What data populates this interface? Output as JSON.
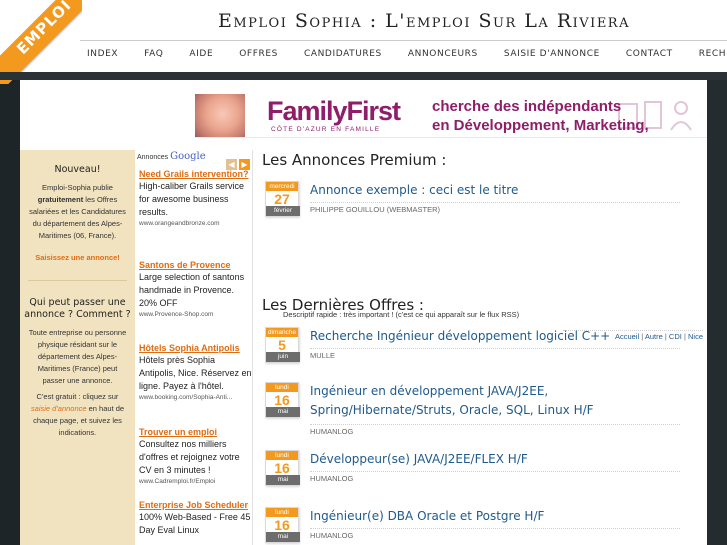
{
  "header": {
    "ribbon": "EMPLOI",
    "site_title": "Emploi Sophia : L'emploi Sur La Riviera"
  },
  "nav": [
    {
      "label": "INDEX"
    },
    {
      "label": "FAQ"
    },
    {
      "label": "AIDE"
    },
    {
      "label": "OFFRES"
    },
    {
      "label": "CANDIDATURES"
    },
    {
      "label": "ANNONCEURS"
    },
    {
      "label": "SAISIE D'ANNONCE"
    },
    {
      "label": "CONTACT"
    },
    {
      "label": "RECHERCHE"
    }
  ],
  "banner": {
    "logo": "FamilyFirst",
    "subtitle": "CÔTE D'AZUR EN FAMILLE",
    "line1": "cherche des indépendants",
    "line2": "en Développement, Marketing, Ventes..."
  },
  "left": {
    "nouveau_title": "Nouveau!",
    "nouveau_1": "Emploi-Sophia publie",
    "nouveau_bold": "gratuitement",
    "nouveau_2": " les Offres salariées et les Candidatures du département des Alpes-Maritimes (06, France).",
    "saisissez": "Saisissez une annonce!",
    "qui_title": "Qui peut passer une annonce ? Comment ?",
    "qui_text": "Toute entreprise ou personne physique résidant sur le département des Alpes-Maritimes (France) peut passer une annonce.",
    "gratuit_1": "C'est gratuit : cliquez sur ",
    "gratuit_link": "saisie d'annonce",
    "gratuit_2": " en haut de chaque page, et suivez les indications."
  },
  "ads": {
    "brand_prefix": "Annonces",
    "brand_google": "Google",
    "items": [
      {
        "title": "Need Grails intervention?",
        "body": "High-caliber Grails service for awesome business results.",
        "url": "www.orangeandbronze.com"
      },
      {
        "title": "Santons de Provence",
        "body": "Large selection of santons handmade in Provence. 20% OFF",
        "url": "www.Provence-Shop.com"
      },
      {
        "title": "Hôtels Sophia Antipolis",
        "body": "Hôtels près Sophia Antipolis, Nice. Réservez en ligne. Payez à l'hôtel.",
        "url": "www.booking.com/Sophia-Anti..."
      },
      {
        "title": "Trouver un emploi",
        "body": "Consultez nos milliers d'offres et rejoignez votre CV en 3 minutes !",
        "url": "www.Cadremploi.fr/Emploi"
      },
      {
        "title": "Enterprise Job Scheduler",
        "body": "100% Web-Based - Free 45 Day Eval Linux",
        "url": ""
      }
    ]
  },
  "premium": {
    "title": "Les Annonces Premium :",
    "item": {
      "day": "mercredi",
      "num": "27",
      "month": "février",
      "title": "Annonce exemple : ceci est le titre",
      "author": "PHILIPPE GOUILLOU (WEBMASTER)"
    },
    "desc": "Descriptif rapide : très important ! (c'est ce qui apparaît sur le flux RSS)",
    "cats": [
      "Accueil",
      "Autre",
      "CDI",
      "Nice"
    ]
  },
  "offres": {
    "title": "Les Dernières Offres :",
    "items": [
      {
        "day": "dimanche",
        "num": "5",
        "month": "juin",
        "title": "Recherche Ingénieur développement logiciel C++",
        "author": "MULLE"
      },
      {
        "day": "lundi",
        "num": "16",
        "month": "mai",
        "title": "Ingénieur en développement JAVA/J2EE, Spring/Hibernate/Struts, Oracle, SQL, Linux H/F",
        "author": "HUMANLOG"
      },
      {
        "day": "lundi",
        "num": "16",
        "month": "mai",
        "title": "Développeur(se) JAVA/J2EE/FLEX H/F",
        "author": "HUMANLOG"
      },
      {
        "day": "lundi",
        "num": "16",
        "month": "mai",
        "title": "Ingénieur(e) DBA Oracle et Postgre H/F",
        "author": "HUMANLOG"
      }
    ]
  },
  "colors": {
    "accent": "#f39a1e",
    "link": "#1f5a8c",
    "sidebar_bg": "#f1e3bf",
    "brand": "#8e1e6a",
    "background": "#1e2528"
  }
}
